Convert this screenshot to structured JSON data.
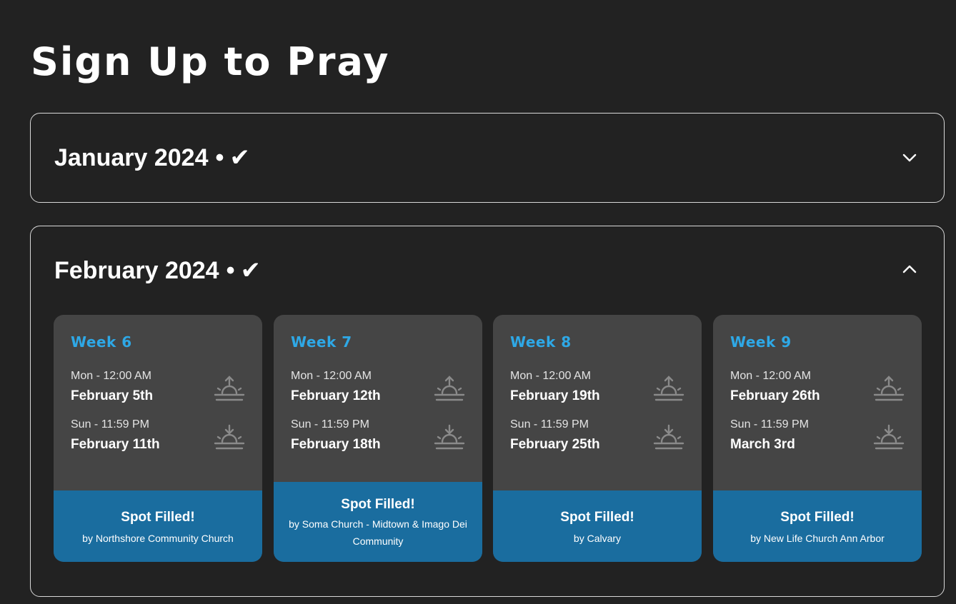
{
  "page": {
    "title": "Sign Up to Pray"
  },
  "colors": {
    "background": "#222222",
    "card": "#454545",
    "accent": "#2ea8e6",
    "filled_banner": "#1a6d9f",
    "border": "#d9d9d9"
  },
  "months": [
    {
      "label": "January 2024",
      "separator": "•",
      "status": "✔",
      "expanded": false,
      "chevron": "chevron-down-icon"
    },
    {
      "label": "February 2024",
      "separator": "•",
      "status": "✔",
      "expanded": true,
      "chevron": "chevron-up-icon"
    }
  ],
  "weeks": [
    {
      "label": "Week 6",
      "start": {
        "time": "Mon - 12:00 AM",
        "date": "February 5th",
        "icon": "sunrise-icon"
      },
      "end": {
        "time": "Sun - 11:59 PM",
        "date": "February 11th",
        "icon": "sunset-icon"
      },
      "status": "Spot Filled!",
      "filled_by": "by Northshore Community Church"
    },
    {
      "label": "Week 7",
      "start": {
        "time": "Mon - 12:00 AM",
        "date": "February 12th",
        "icon": "sunrise-icon"
      },
      "end": {
        "time": "Sun - 11:59 PM",
        "date": "February 18th",
        "icon": "sunset-icon"
      },
      "status": "Spot Filled!",
      "filled_by": "by Soma Church - Midtown & Imago Dei Community"
    },
    {
      "label": "Week 8",
      "start": {
        "time": "Mon - 12:00 AM",
        "date": "February 19th",
        "icon": "sunrise-icon"
      },
      "end": {
        "time": "Sun - 11:59 PM",
        "date": "February 25th",
        "icon": "sunset-icon"
      },
      "status": "Spot Filled!",
      "filled_by": "by Calvary"
    },
    {
      "label": "Week 9",
      "start": {
        "time": "Mon - 12:00 AM",
        "date": "February 26th",
        "icon": "sunrise-icon"
      },
      "end": {
        "time": "Sun - 11:59 PM",
        "date": "March 3rd",
        "icon": "sunset-icon"
      },
      "status": "Spot Filled!",
      "filled_by": "by New Life Church Ann Arbor"
    }
  ]
}
